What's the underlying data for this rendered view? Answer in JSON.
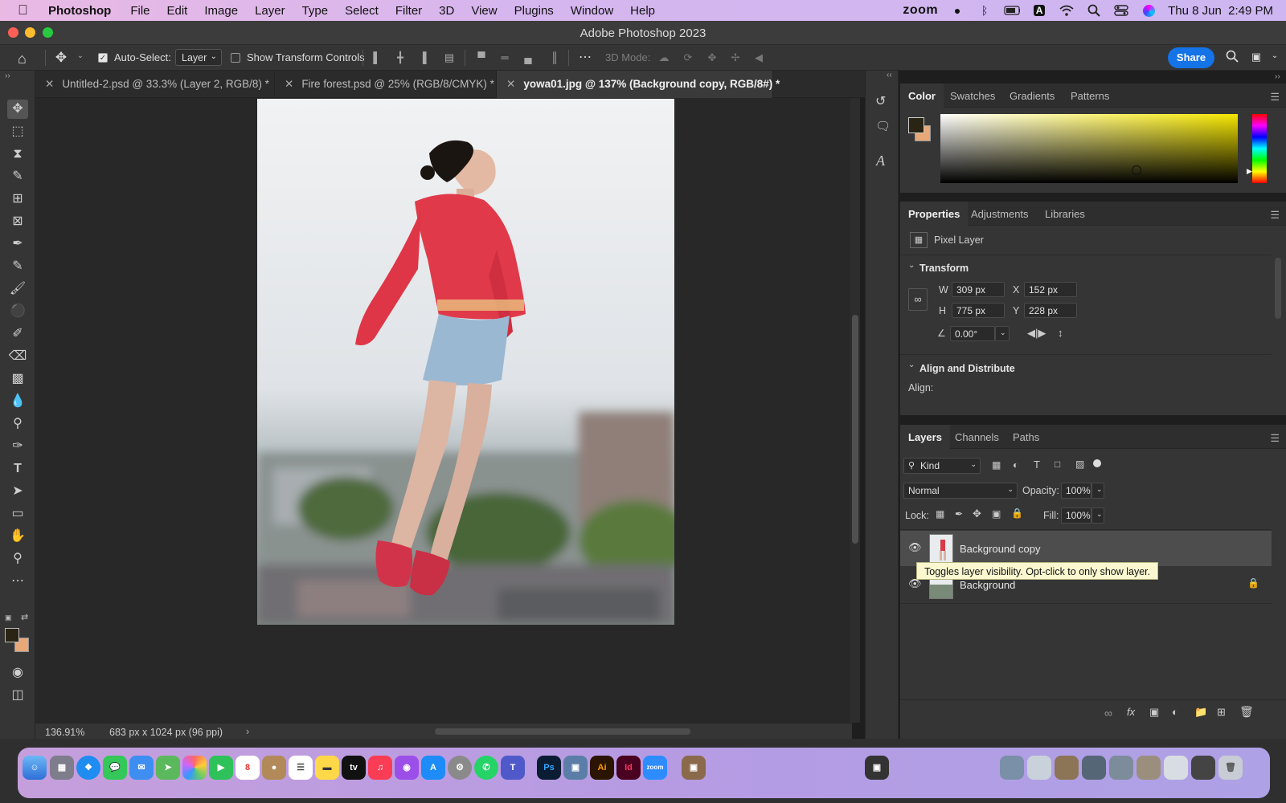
{
  "menubar": {
    "app": "Photoshop",
    "items": [
      "File",
      "Edit",
      "Image",
      "Layer",
      "Type",
      "Select",
      "Filter",
      "3D",
      "View",
      "Plugins",
      "Window",
      "Help"
    ],
    "zoom": "zoom",
    "clock": "Thu 8 Jun  2:49 PM"
  },
  "window": {
    "title": "Adobe Photoshop 2023"
  },
  "options": {
    "auto_select_label": "Auto-Select:",
    "auto_select_value": "Layer",
    "transform_label": "Show Transform Controls",
    "mode3d_label": "3D Mode:",
    "share_label": "Share"
  },
  "tabs": [
    {
      "label": "Untitled-2.psd @ 33.3% (Layer 2, RGB/8) *"
    },
    {
      "label": "Fire forest.psd @ 25% (RGB/8/CMYK) *"
    },
    {
      "label": "yowa01.jpg @ 137% (Background copy, RGB/8#) *"
    }
  ],
  "status": {
    "zoom": "136.91%",
    "doc": "683 px x 1024 px (96 ppi)"
  },
  "color_panel": {
    "tabs": [
      "Color",
      "Swatches",
      "Gradients",
      "Patterns"
    ],
    "foreground": "#2a2414",
    "background": "#e8a878"
  },
  "properties": {
    "tabs": [
      "Properties",
      "Adjustments",
      "Libraries"
    ],
    "layer_type": "Pixel Layer",
    "transform_title": "Transform",
    "w_label": "W",
    "w": "309 px",
    "h_label": "H",
    "h": "775 px",
    "x_label": "X",
    "x": "152 px",
    "y_label": "Y",
    "y": "228 px",
    "angle": "0.00°",
    "align_title": "Align and Distribute",
    "align_label": "Align:"
  },
  "layers_panel": {
    "tabs": [
      "Layers",
      "Channels",
      "Paths"
    ],
    "filter": "Kind",
    "blend": "Normal",
    "opacity_label": "Opacity:",
    "opacity": "100%",
    "lock_label": "Lock:",
    "fill_label": "Fill:",
    "fill": "100%",
    "layers": [
      {
        "name": "Background copy"
      },
      {
        "name": "Background"
      }
    ],
    "tooltip": "Toggles layer visibility. Opt-click to only show layer."
  },
  "colors": {
    "accent": "#1473e6"
  }
}
